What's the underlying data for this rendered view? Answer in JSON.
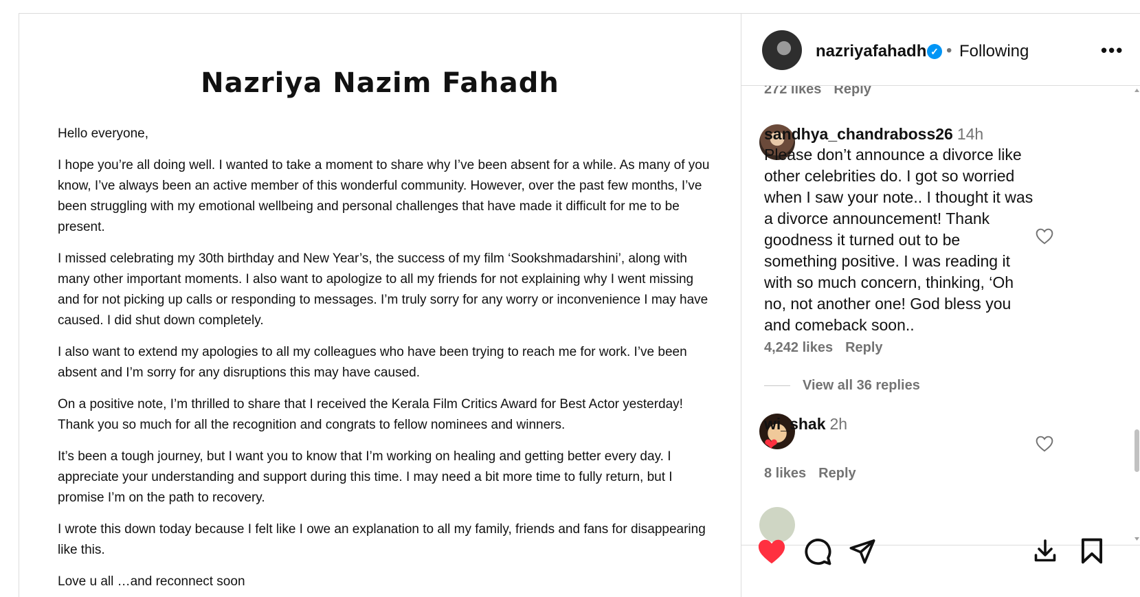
{
  "note": {
    "title": "Nazriya Nazim Fahadh",
    "paragraphs": [
      "Hello everyone,",
      "I hope you’re all doing well. I wanted to take a moment to share why I’ve been absent for a while. As many of you know, I’ve always been an active member of this wonderful community. However, over the past few months, I’ve been struggling with my emotional wellbeing and personal challenges that have made it difficult for me to be present.",
      "I missed celebrating my 30th birthday and New Year’s, the success of my film ‘Sookshmadarshini’, along with many other important moments. I also want to apologize to all my friends for not explaining why I went missing and for not picking up calls or responding to messages. I’m truly sorry for any worry or inconvenience I may have caused. I did shut down completely.",
      "I also want to extend my apologies to all my colleagues who have been trying to reach me for work. I’ve been absent and I’m sorry for any disruptions this may have caused.",
      "On a positive note, I’m thrilled to share that I received the Kerala Film Critics Award for Best Actor yesterday! Thank you so much for all the recognition and congrats to fellow nominees and winners.",
      "It’s been a tough journey, but I want you to know that I’m working on healing and getting better every day. I appreciate your understanding and support during this time. I may need a bit more time to fully return, but I promise I’m on the path to recovery.",
      "I wrote this down today because I felt like I owe an explanation to all my family, friends and fans for disappearing like this.",
      "Love u all …and reconnect soon"
    ]
  },
  "header": {
    "username": "nazriyafahadh",
    "verified_mark": "✓",
    "separator": "•",
    "follow_status": "Following",
    "more": "•••"
  },
  "comments": {
    "top_meta": {
      "likes": "272 likes",
      "reply": "Reply"
    },
    "items": [
      {
        "username": "sandhya_chandraboss26",
        "time": "14h",
        "text": "Please don’t announce a divorce like other celebrities do. I got so worried when I saw your note.. I thought it was a divorce announcement! Thank goodness it turned out to be something positive. I was reading it with so much concern, thinking, ‘Oh no, not another one! God bless you and comeback soon..",
        "likes": "4,242 likes",
        "reply": "Reply",
        "view_replies": "View all 36 replies"
      },
      {
        "username": "wi_shak",
        "time": "2h",
        "text": "❤",
        "likes": "8 likes",
        "reply": "Reply"
      }
    ]
  },
  "colors": {
    "like_red": "#ff3040",
    "verified_blue": "#0095f6",
    "muted": "#737373"
  },
  "icons": [
    "heart-filled-icon",
    "comment-icon",
    "share-icon",
    "download-icon",
    "bookmark-icon",
    "heart-outline-icon",
    "more-icon",
    "verified-icon"
  ]
}
